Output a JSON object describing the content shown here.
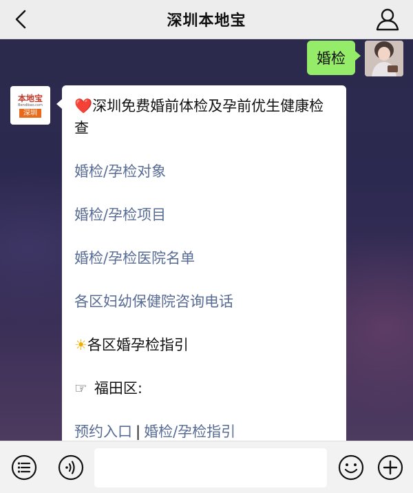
{
  "header": {
    "title": "深圳本地宝",
    "back_icon": "chevron-left-icon",
    "profile_icon": "person-icon"
  },
  "my_message": {
    "text": "婚检"
  },
  "bot": {
    "avatar_logo_top": "本地宝",
    "avatar_logo_url": "Bendibao.com",
    "avatar_logo_city": "深圳"
  },
  "bot_message": {
    "heart": "❤️",
    "title": "深圳免费婚前体检及孕前优生健康检查",
    "links": [
      "婚检/孕检对象",
      "婚检/孕检项目",
      "婚检/孕检医院名单",
      "各区妇幼保健院咨询电话"
    ],
    "section_icon": "☀",
    "section_title": "各区婚孕检指引",
    "district_icon": "☞",
    "district_name": "福田区:",
    "district_link1": "预约入口",
    "district_sep": "|",
    "district_link2": "婚检/孕检指引"
  },
  "footer": {
    "menu_icon": "list-icon",
    "voice_icon": "voice-icon",
    "emoji_icon": "smiley-icon",
    "plus_icon": "plus-icon",
    "input_value": ""
  },
  "colors": {
    "my_bubble": "#95ec69",
    "link": "#576b95",
    "bar": "#ededed"
  }
}
